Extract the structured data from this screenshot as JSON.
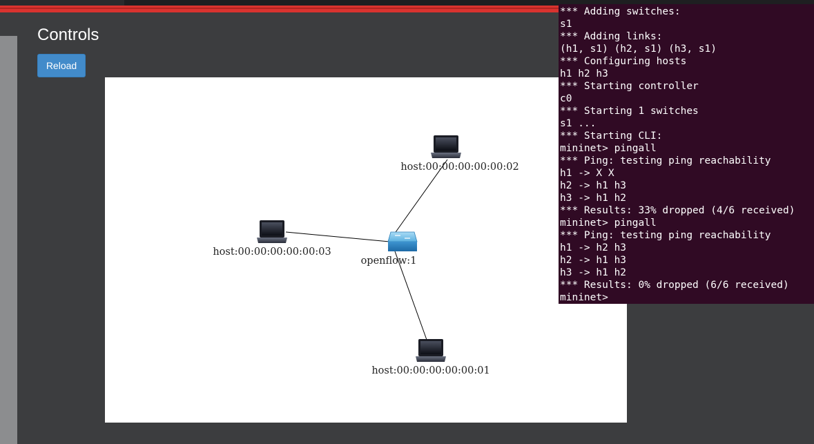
{
  "controls": {
    "title": "Controls",
    "reload_label": "Reload"
  },
  "topology": {
    "nodes": {
      "switch": {
        "label": "openflow:1",
        "icon": "switch-icon"
      },
      "host1": {
        "label": "host:00:00:00:00:00:01",
        "icon": "laptop-icon"
      },
      "host2": {
        "label": "host:00:00:00:00:00:02",
        "icon": "laptop-icon"
      },
      "host3": {
        "label": "host:00:00:00:00:00:03",
        "icon": "laptop-icon"
      }
    },
    "links": [
      [
        "openflow:1",
        "host:00:00:00:00:00:02"
      ],
      [
        "openflow:1",
        "host:00:00:00:00:00:03"
      ],
      [
        "openflow:1",
        "host:00:00:00:00:00:01"
      ]
    ]
  },
  "terminal": {
    "lines": [
      "*** Adding switches:",
      "s1",
      "*** Adding links:",
      "(h1, s1) (h2, s1) (h3, s1)",
      "*** Configuring hosts",
      "h1 h2 h3",
      "*** Starting controller",
      "c0",
      "*** Starting 1 switches",
      "s1 ...",
      "*** Starting CLI:",
      "mininet> pingall",
      "*** Ping: testing ping reachability",
      "h1 -> X X",
      "h2 -> h1 h3",
      "h3 -> h1 h2",
      "*** Results: 33% dropped (4/6 received)",
      "mininet> pingall",
      "*** Ping: testing ping reachability",
      "h1 -> h2 h3",
      "h2 -> h1 h3",
      "h3 -> h1 h2",
      "*** Results: 0% dropped (6/6 received)",
      "mininet>"
    ]
  },
  "colors": {
    "accent": "#428bca",
    "header_stripe": "#d9332f",
    "terminal_bg": "#300a24",
    "page_bg": "#3c3d3f"
  }
}
